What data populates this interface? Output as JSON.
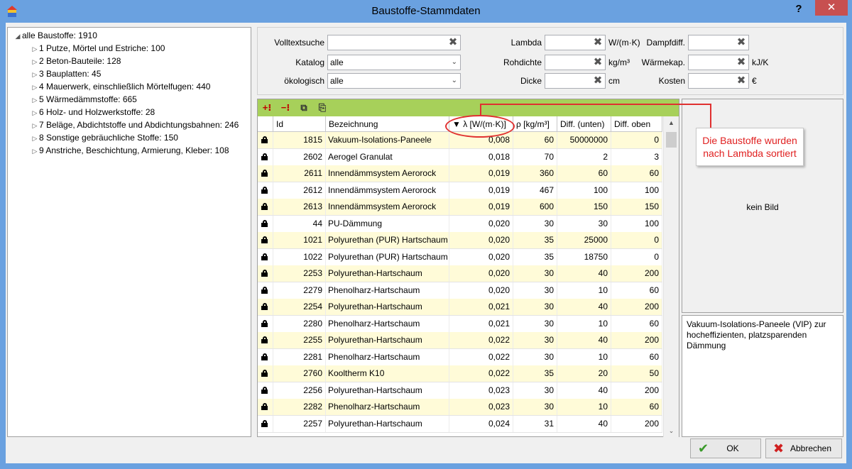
{
  "window": {
    "title": "Baustoffe-Stammdaten",
    "help_label": "?",
    "close_label": "✕"
  },
  "tree": {
    "root": "alle Baustoffe: 1910",
    "items": [
      "1 Putze, Mörtel und Estriche: 100",
      "2 Beton-Bauteile: 128",
      "3 Bauplatten: 45",
      "4 Mauerwerk, einschließlich Mörtelfugen: 440",
      "5 Wärmedämmstoffe: 665",
      "6 Holz- und Holzwerkstoffe: 28",
      "7 Beläge, Abdichtstoffe und Abdichtungsbahnen: 246",
      "8 Sonstige gebräuchliche Stoffe: 150",
      "9 Anstriche, Beschichtung, Armierung, Kleber: 108"
    ]
  },
  "filters": {
    "volltextsuche_label": "Volltextsuche",
    "volltextsuche_value": "",
    "katalog_label": "Katalog",
    "katalog_value": "alle",
    "oekologisch_label": "ökologisch",
    "oekologisch_value": "alle",
    "lambda_label": "Lambda",
    "lambda_value": "",
    "lambda_unit": "W/(m·K)",
    "rohdichte_label": "Rohdichte",
    "rohdichte_value": "",
    "rohdichte_unit": "kg/m³",
    "dicke_label": "Dicke",
    "dicke_value": "",
    "dicke_unit": "cm",
    "dampfdiff_label": "Dampfdiff.",
    "dampfdiff_value": "",
    "waermekap_label": "Wärmekap.",
    "waermekap_value": "",
    "waermekap_unit": "kJ/K",
    "kosten_label": "Kosten",
    "kosten_value": "",
    "kosten_unit": "€"
  },
  "grid": {
    "columns": {
      "id": "Id",
      "name": "Bezeichnung",
      "lambda": "▼ λ [W/(m·K)]",
      "rho": "ρ [kg/m³]",
      "diff_unten": "Diff. (unten)",
      "diff_oben": "Diff. oben"
    },
    "rows": [
      {
        "id": "1815",
        "name": "Vakuum-Isolations-Paneele",
        "lambda": "0,008",
        "rho": "60",
        "diff_unten": "50000000",
        "diff_oben": "0"
      },
      {
        "id": "2602",
        "name": "Aerogel Granulat",
        "lambda": "0,018",
        "rho": "70",
        "diff_unten": "2",
        "diff_oben": "3"
      },
      {
        "id": "2611",
        "name": "Innendämmsystem Aerorock",
        "lambda": "0,019",
        "rho": "360",
        "diff_unten": "60",
        "diff_oben": "60"
      },
      {
        "id": "2612",
        "name": "Innendämmsystem Aerorock",
        "lambda": "0,019",
        "rho": "467",
        "diff_unten": "100",
        "diff_oben": "100"
      },
      {
        "id": "2613",
        "name": "Innendämmsystem Aerorock",
        "lambda": "0,019",
        "rho": "600",
        "diff_unten": "150",
        "diff_oben": "150"
      },
      {
        "id": "44",
        "name": "PU-Dämmung",
        "lambda": "0,020",
        "rho": "30",
        "diff_unten": "30",
        "diff_oben": "100"
      },
      {
        "id": "1021",
        "name": "Polyurethan (PUR) Hartschaum",
        "lambda": "0,020",
        "rho": "35",
        "diff_unten": "25000",
        "diff_oben": "0"
      },
      {
        "id": "1022",
        "name": "Polyurethan (PUR) Hartschaum",
        "lambda": "0,020",
        "rho": "35",
        "diff_unten": "18750",
        "diff_oben": "0"
      },
      {
        "id": "2253",
        "name": "Polyurethan-Hartschaum",
        "lambda": "0,020",
        "rho": "30",
        "diff_unten": "40",
        "diff_oben": "200"
      },
      {
        "id": "2279",
        "name": "Phenolharz-Hartschaum",
        "lambda": "0,020",
        "rho": "30",
        "diff_unten": "10",
        "diff_oben": "60"
      },
      {
        "id": "2254",
        "name": "Polyurethan-Hartschaum",
        "lambda": "0,021",
        "rho": "30",
        "diff_unten": "40",
        "diff_oben": "200"
      },
      {
        "id": "2280",
        "name": "Phenolharz-Hartschaum",
        "lambda": "0,021",
        "rho": "30",
        "diff_unten": "10",
        "diff_oben": "60"
      },
      {
        "id": "2255",
        "name": "Polyurethan-Hartschaum",
        "lambda": "0,022",
        "rho": "30",
        "diff_unten": "40",
        "diff_oben": "200"
      },
      {
        "id": "2281",
        "name": "Phenolharz-Hartschaum",
        "lambda": "0,022",
        "rho": "30",
        "diff_unten": "10",
        "diff_oben": "60"
      },
      {
        "id": "2760",
        "name": "Kooltherm K10",
        "lambda": "0,022",
        "rho": "35",
        "diff_unten": "20",
        "diff_oben": "50"
      },
      {
        "id": "2256",
        "name": "Polyurethan-Hartschaum",
        "lambda": "0,023",
        "rho": "30",
        "diff_unten": "40",
        "diff_oben": "200"
      },
      {
        "id": "2282",
        "name": "Phenolharz-Hartschaum",
        "lambda": "0,023",
        "rho": "30",
        "diff_unten": "10",
        "diff_oben": "60"
      },
      {
        "id": "2257",
        "name": "Polyurethan-Hartschaum",
        "lambda": "0,024",
        "rho": "31",
        "diff_unten": "40",
        "diff_oben": "200"
      }
    ]
  },
  "image_panel": {
    "text": "kein Bild"
  },
  "description": "Vakuum-Isolations-Paneele (VIP) zur hocheffizienten, platzsparenden Dämmung",
  "annotation": "Die Baustoffe wurden nach Lambda sortiert",
  "buttons": {
    "ok": "OK",
    "cancel": "Abbrechen"
  },
  "colors": {
    "title_bar": "#6aa1e0",
    "toolbar": "#a7d05a",
    "alt_row": "#fffbd8",
    "annotation": "#e03030"
  }
}
